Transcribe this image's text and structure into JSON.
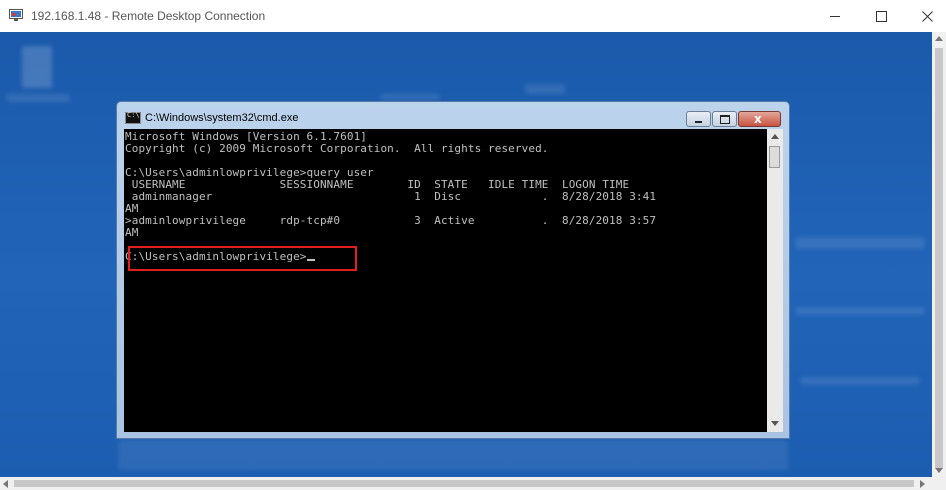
{
  "rdc": {
    "title": "192.168.1.48 - Remote Desktop Connection",
    "icon": "remote-desktop-icon",
    "controls": [
      "minimize-icon",
      "maximize-icon",
      "close-icon"
    ]
  },
  "cmd": {
    "title": "C:\\Windows\\system32\\cmd.exe",
    "icon": "cmd-icon",
    "lines": [
      "Microsoft Windows [Version 6.1.7601]",
      "Copyright (c) 2009 Microsoft Corporation.  All rights reserved.",
      "",
      "C:\\Users\\adminlowprivilege>query user",
      " USERNAME              SESSIONNAME        ID  STATE   IDLE TIME  LOGON TIME",
      " adminmanager                              1  Disc            .  8/28/2018 3:41",
      "AM",
      ">adminlowprivilege     rdp-tcp#0           3  Active          .  8/28/2018 3:57",
      "AM",
      ""
    ],
    "prompt": "C:\\Users\\adminlowprivilege>"
  },
  "colors": {
    "desktop": "#1d5fb3",
    "console_bg": "#000000",
    "console_text": "#c0c0c0",
    "highlight": "#e02020"
  }
}
